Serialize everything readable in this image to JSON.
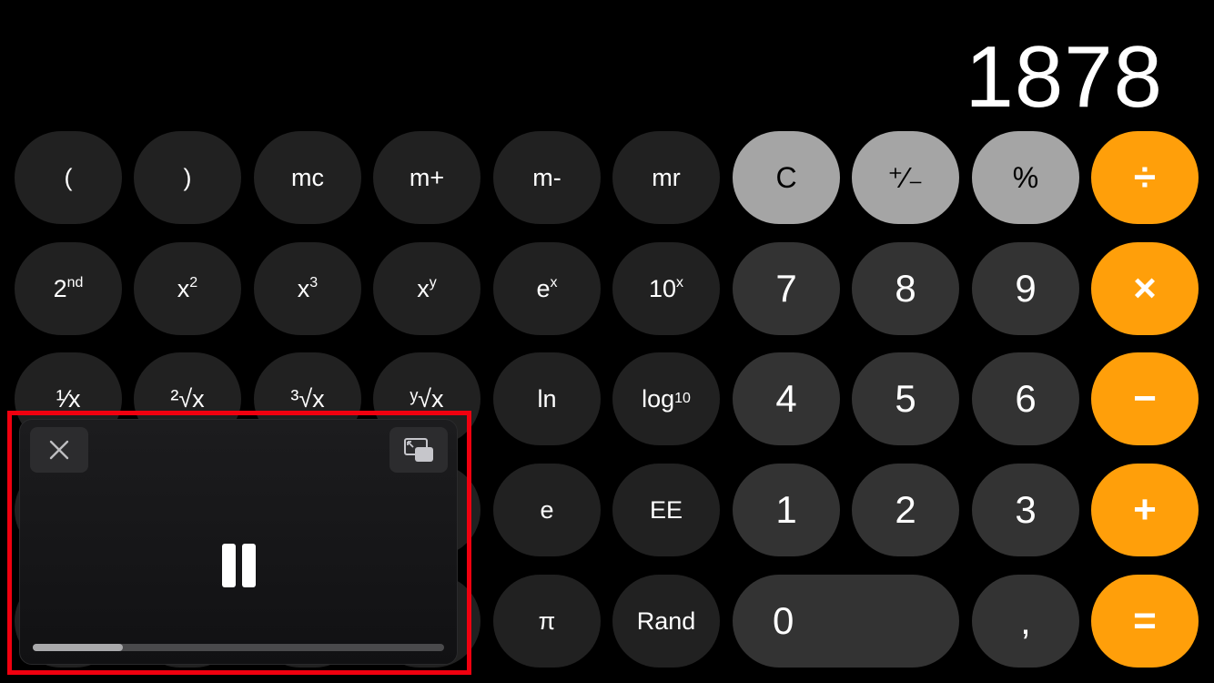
{
  "display": {
    "value": "1878"
  },
  "rows": [
    [
      {
        "t": "("
      },
      {
        "t": ")"
      },
      {
        "t": "mc"
      },
      {
        "t": "m+"
      },
      {
        "t": "m-"
      },
      {
        "t": "mr"
      },
      {
        "t": "C"
      },
      {
        "t": "⁺∕₋"
      },
      {
        "t": "%"
      },
      {
        "t": "÷"
      }
    ],
    [
      {
        "t": "2",
        "s": "nd"
      },
      {
        "t": "x",
        "s": "2"
      },
      {
        "t": "x",
        "s": "3"
      },
      {
        "t": "x",
        "s": "y"
      },
      {
        "t": "e",
        "s": "x"
      },
      {
        "t": "10",
        "s": "x"
      },
      {
        "t": "7"
      },
      {
        "t": "8"
      },
      {
        "t": "9"
      },
      {
        "t": "×"
      }
    ],
    [
      {
        "t": "¹∕x"
      },
      {
        "t": "²√x"
      },
      {
        "t": "³√x"
      },
      {
        "t": "ʸ√x"
      },
      {
        "t": "ln"
      },
      {
        "t": "log",
        "b": "10"
      },
      {
        "t": "4"
      },
      {
        "t": "5"
      },
      {
        "t": "6"
      },
      {
        "t": "−"
      }
    ],
    [
      {
        "t": ""
      },
      {
        "t": ""
      },
      {
        "t": ""
      },
      {
        "t": ""
      },
      {
        "t": "e"
      },
      {
        "t": "EE"
      },
      {
        "t": "1"
      },
      {
        "t": "2"
      },
      {
        "t": "3"
      },
      {
        "t": "+"
      }
    ],
    [
      {
        "t": ""
      },
      {
        "t": ""
      },
      {
        "t": ""
      },
      {
        "t": ""
      },
      {
        "t": "π"
      },
      {
        "t": "Rand"
      },
      {
        "t": "0"
      },
      {
        "t": ","
      },
      {
        "t": "="
      }
    ]
  ],
  "pip": {
    "close_icon": "close-icon",
    "restore_icon": "picture-in-picture-restore-icon",
    "state_icon": "pause-icon",
    "progress_fraction": 0.22,
    "highlight_color": "#f0000f"
  },
  "colors": {
    "operator": "#ff9f0a",
    "function": "#a5a5a5",
    "digit": "#333333",
    "scientific": "#212121"
  }
}
